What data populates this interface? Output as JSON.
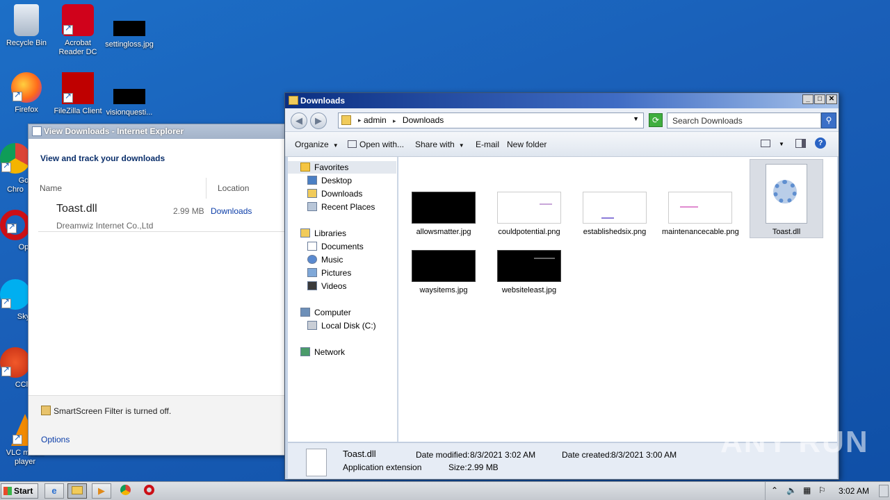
{
  "desktop": {
    "icons": [
      {
        "label": "Recycle Bin",
        "icon": "recycle-bin-icon"
      },
      {
        "label": "Acrobat Reader DC",
        "icon": "acrobat-icon"
      },
      {
        "label": "settingloss.jpg",
        "icon": "image-file-icon"
      },
      {
        "label": "Firefox",
        "icon": "firefox-icon"
      },
      {
        "label": "FileZilla Client",
        "icon": "filezilla-icon"
      },
      {
        "label": "visionquesti...",
        "icon": "image-file-icon"
      },
      {
        "label": "Goo Chro",
        "icon": "chrome-icon"
      },
      {
        "label": "Ope",
        "icon": "opera-icon"
      },
      {
        "label": "Skyp",
        "icon": "skype-icon"
      },
      {
        "label": "CClea",
        "icon": "ccleaner-icon"
      },
      {
        "label": "VLC media player",
        "icon": "vlc-icon"
      }
    ]
  },
  "ie_downloads": {
    "title": "View Downloads - Internet Explorer",
    "heading": "View and track your downloads",
    "columns": {
      "name": "Name",
      "location": "Location"
    },
    "item": {
      "name": "Toast.dll",
      "size": "2.99 MB",
      "location": "Downloads",
      "publisher": "Dreamwiz Internet Co.,Ltd"
    },
    "smartscreen": "SmartScreen Filter is turned off.",
    "options": "Options"
  },
  "explorer": {
    "title": "Downloads",
    "breadcrumb": [
      "admin",
      "Downloads"
    ],
    "search_placeholder": "Search Downloads",
    "toolbar": {
      "organize": "Organize",
      "open_with": "Open with...",
      "share_with": "Share with",
      "email": "E-mail",
      "new_folder": "New folder"
    },
    "nav": {
      "favorites": "Favorites",
      "desktop": "Desktop",
      "downloads": "Downloads",
      "recent": "Recent Places",
      "libraries": "Libraries",
      "documents": "Documents",
      "music": "Music",
      "pictures": "Pictures",
      "videos": "Videos",
      "computer": "Computer",
      "local_disk": "Local Disk (C:)",
      "network": "Network"
    },
    "files": [
      {
        "name": "allowsmatter.jpg"
      },
      {
        "name": "couldpotential.png"
      },
      {
        "name": "establishedsix.png"
      },
      {
        "name": "maintenancecable.png"
      },
      {
        "name": "Toast.dll"
      },
      {
        "name": "waysitems.jpg"
      },
      {
        "name": "websiteleast.jpg"
      }
    ],
    "details": {
      "name": "Toast.dll",
      "type": "Application extension",
      "date_modified_label": "Date modified:",
      "date_modified": "8/3/2021 3:02 AM",
      "size_label": "Size:",
      "size": "2.99 MB",
      "date_created_label": "Date created:",
      "date_created": "8/3/2021 3:00 AM"
    }
  },
  "taskbar": {
    "start": "Start",
    "clock": "3:02 AM"
  },
  "watermark": "ANY RUN"
}
